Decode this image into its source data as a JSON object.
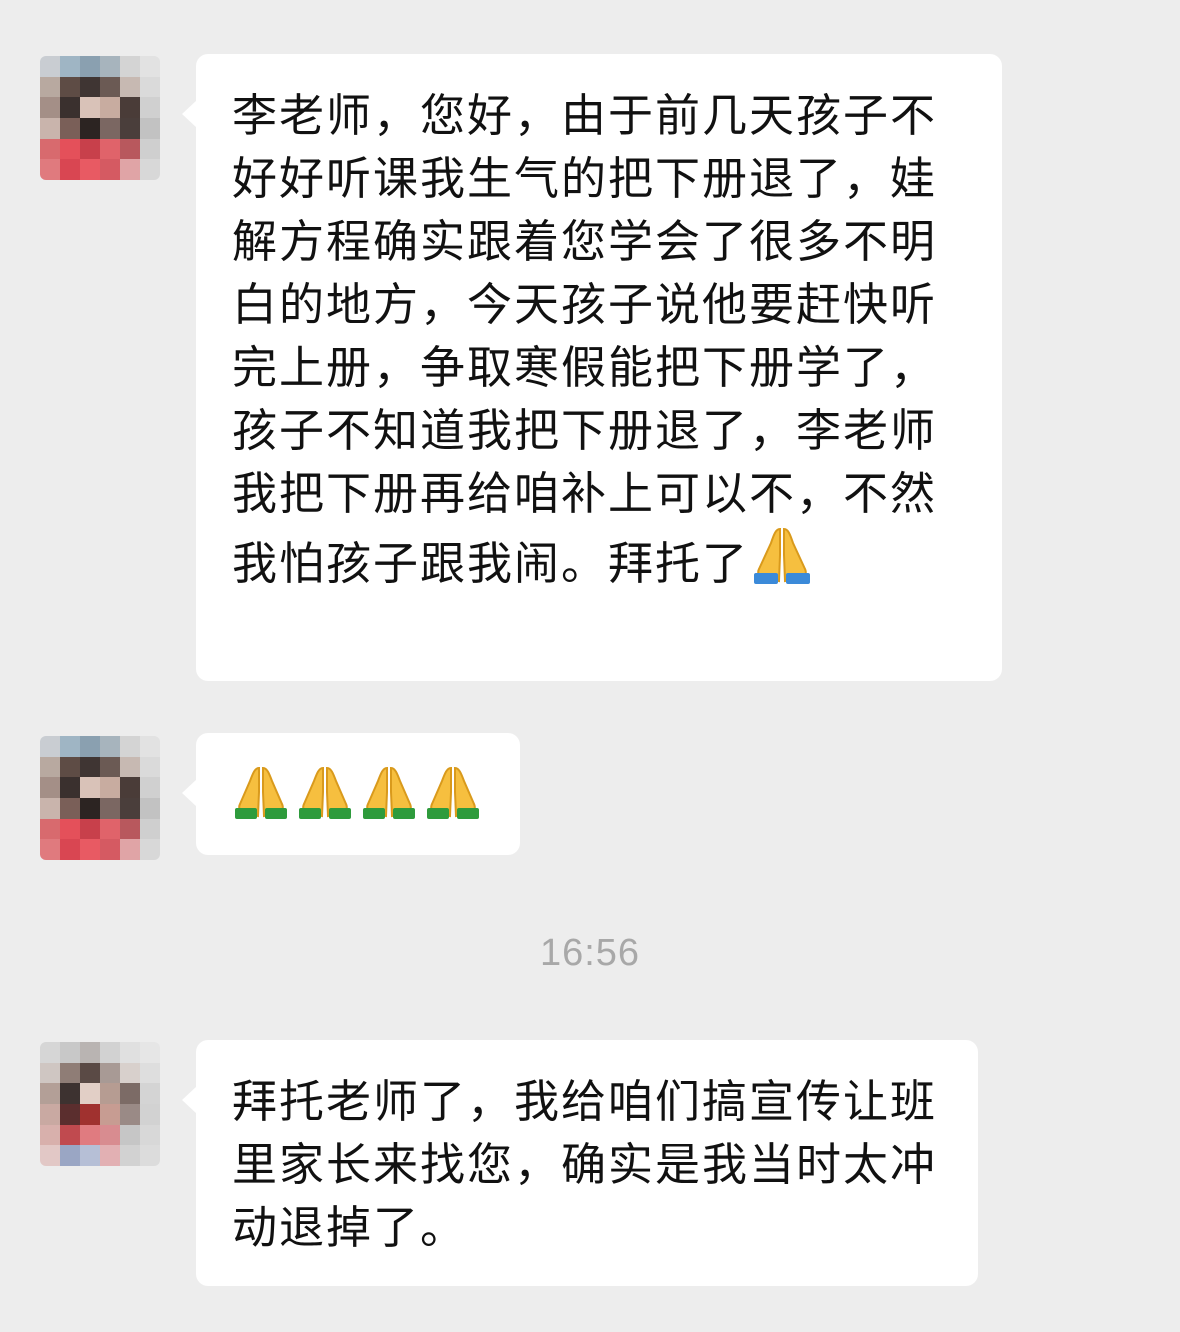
{
  "messages": [
    {
      "text": "李老师，您好，由于前几天孩子不好好听课我生气的把下册退了，娃解方程确实跟着您学会了很多不明白的地方，今天孩子说他要赶快听完上册，争取寒假能把下册学了，孩子不知道我把下册退了，李老师我把下册再给咱补上可以不，不然我怕孩子跟我闹。拜托了",
      "trailing_emoji": "folded-hands-emoji"
    },
    {
      "emoji_count": 4,
      "emoji": "folded-hands-emoji"
    },
    {
      "text": "拜托老师了，我给咱们搞宣传让班里家长来找您，确实是我当时太冲动退掉了。"
    }
  ],
  "timestamp": "16:56",
  "colors": {
    "background": "#ededed",
    "bubble": "#ffffff",
    "text": "#111111",
    "timestamp": "#a8a8a8"
  }
}
